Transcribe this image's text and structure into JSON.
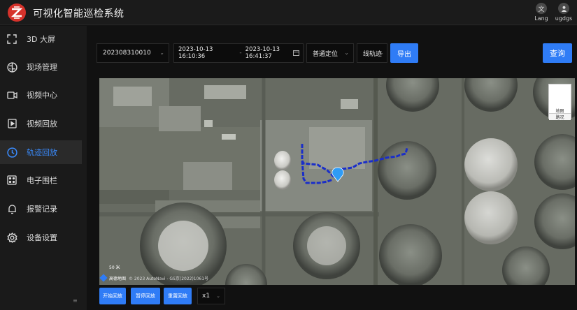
{
  "header": {
    "title": "可视化智能巡检系统",
    "language": {
      "icon": "translate-icon",
      "label": "Lang"
    },
    "user": {
      "icon": "user-icon",
      "label": "ugdgs"
    }
  },
  "sidebar": {
    "items": [
      {
        "label": "3D 大屏",
        "icon": "fullscreen-icon",
        "active": false
      },
      {
        "label": "现场管理",
        "icon": "brain-icon",
        "active": false
      },
      {
        "label": "视频中心",
        "icon": "video-camera-icon",
        "active": false
      },
      {
        "label": "视频回放",
        "icon": "play-icon",
        "active": false
      },
      {
        "label": "轨迹回放",
        "icon": "clock-icon",
        "active": true
      },
      {
        "label": "电子围栏",
        "icon": "fence-grid-icon",
        "active": false
      },
      {
        "label": "报警记录",
        "icon": "bell-icon",
        "active": false
      },
      {
        "label": "设备设置",
        "icon": "gear-icon",
        "active": false
      }
    ],
    "collapse_glyph": "≡"
  },
  "toolbar": {
    "device_id": "202308310010",
    "start_time": "2023-10-13 16:10:36",
    "time_separator": "-",
    "end_time": "2023-10-13 16:41:37",
    "locate_mode": "普通定位",
    "track_mode": "线轨迹",
    "export_label": "导出",
    "query_label": "查询"
  },
  "map": {
    "layers": {
      "satellite": "地图",
      "road": "路况"
    },
    "scale_label": "50 米",
    "attribution_logo": "高德地图",
    "attribution_text": "© 2023 AutoNavi - GS京(2022)1061号"
  },
  "playback": {
    "start_label": "开始回放",
    "pause_label": "暂停回放",
    "reset_label": "重置回放",
    "speed": "x1"
  },
  "colors": {
    "accent": "#2f7cf6",
    "active_text": "#3a8cff",
    "track": "#1a2ec9",
    "background": "#141414"
  }
}
